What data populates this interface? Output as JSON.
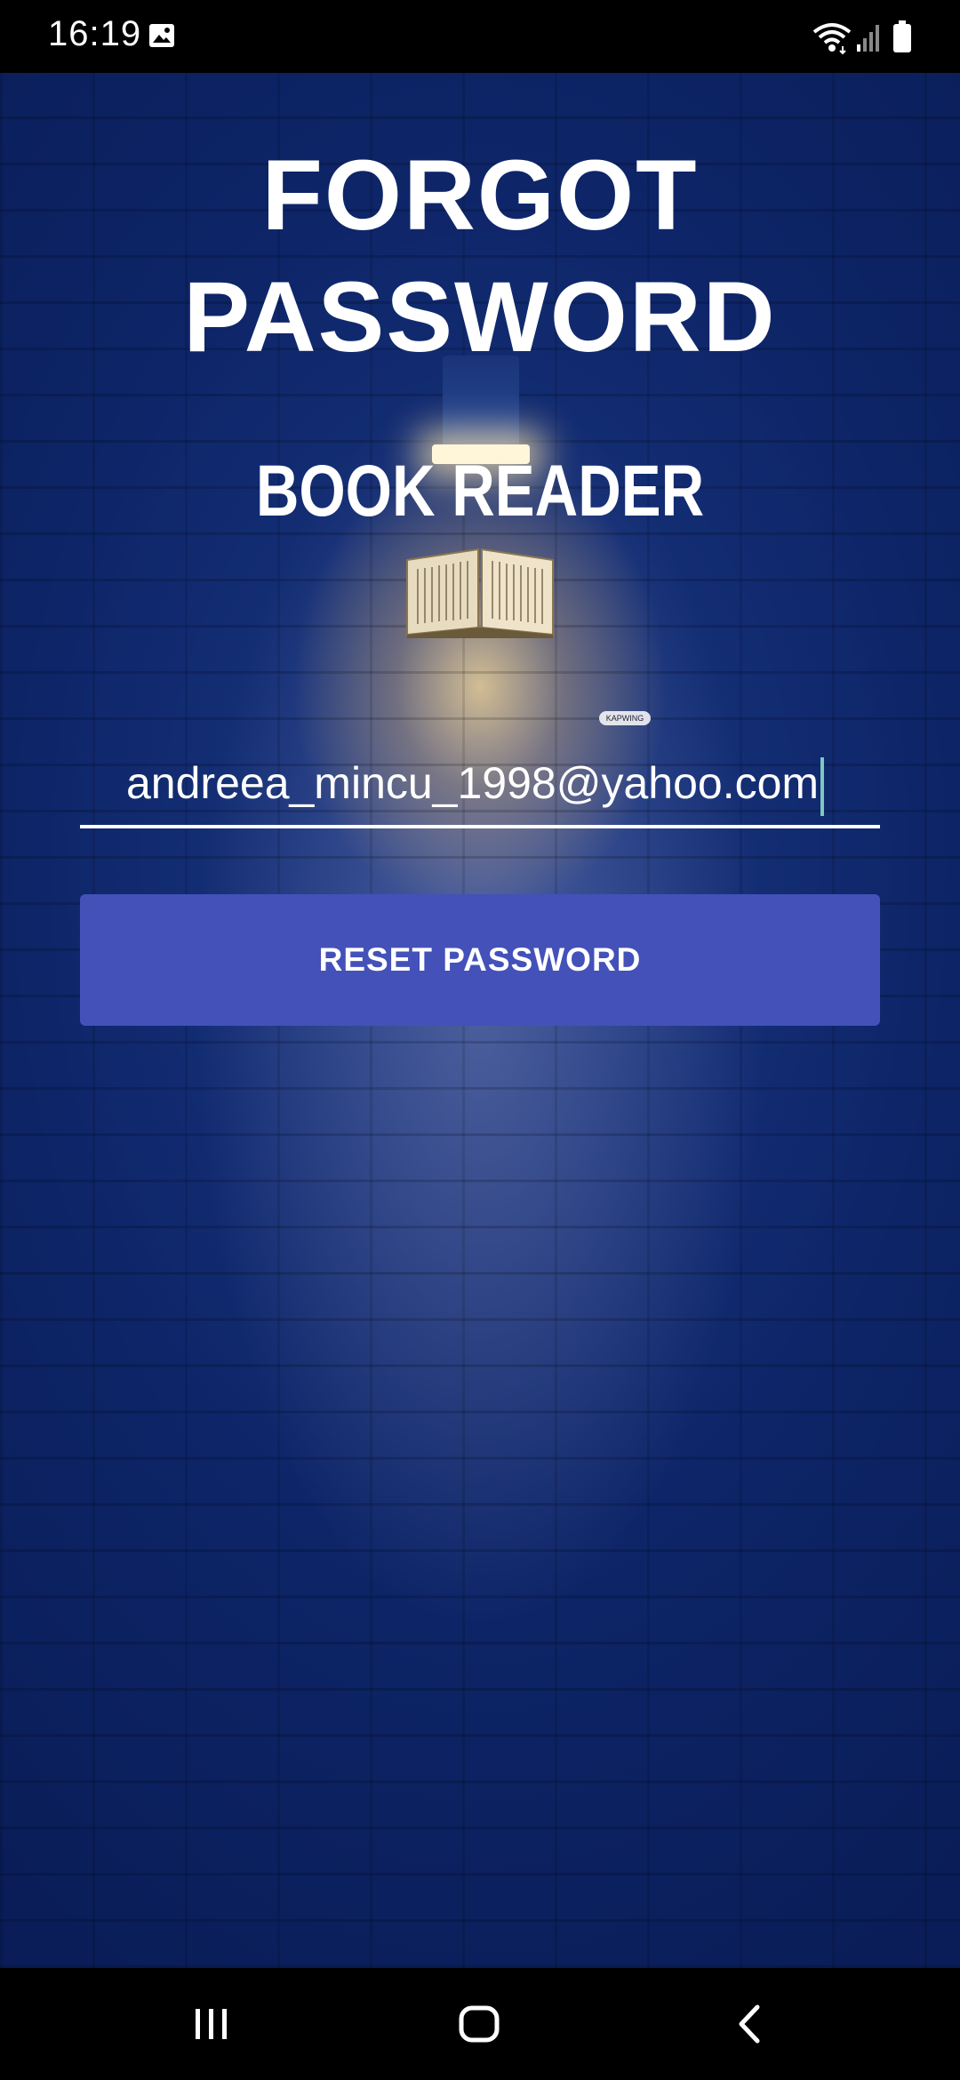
{
  "status_bar": {
    "time": "16:19"
  },
  "page": {
    "title_line1": "FORGOT",
    "title_line2": "PASSWORD",
    "app_name": "BOOK READER",
    "watermark": "KAPWING"
  },
  "form": {
    "email_value": "andreea_mincu_1998@yahoo.com",
    "reset_button_label": "RESET PASSWORD"
  },
  "colors": {
    "background": "#0d2466",
    "button": "#4351b9",
    "text": "#ffffff"
  },
  "icons": {
    "status": [
      "gallery-icon",
      "wifi-icon",
      "signal-icon",
      "battery-icon"
    ],
    "nav": [
      "recents-icon",
      "home-icon",
      "back-icon"
    ]
  }
}
